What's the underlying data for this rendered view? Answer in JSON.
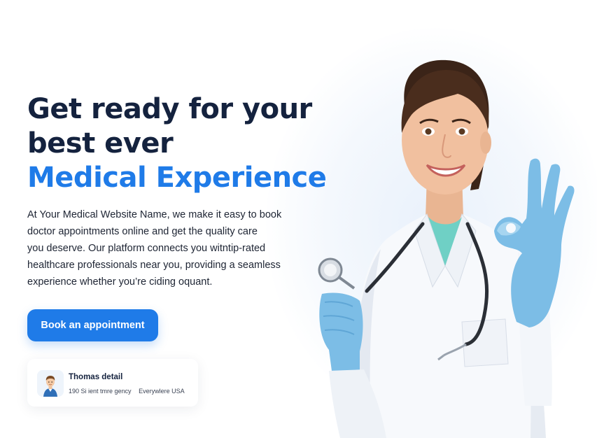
{
  "hero": {
    "headline_line1": "Get ready for your",
    "headline_line2": "best ever",
    "headline_accent": "Medical Experience",
    "description_lines": [
      "At Your Medical Website Name, we make it easy to book",
      "doctor appointments online and get the quality care",
      "you deserve. Our platform connects you witntip-rated",
      "healthcare professionals near you, providing a seamless",
      "experience whether you’re ciding oquant."
    ],
    "cta_label": "Book an appointment"
  },
  "profile_card": {
    "name": "Thomas detail",
    "detail_1": "190 Si ient tmre gency",
    "detail_2": "Everywlere USA"
  },
  "colors": {
    "primary": "#1f7be8",
    "heading": "#14223e",
    "body_text": "#1d2433",
    "glove": "#7cbde6",
    "scrubs": "#6fd0c5"
  },
  "icons": {
    "avatar": "doctor-avatar-icon",
    "photo": "doctor-photo"
  }
}
